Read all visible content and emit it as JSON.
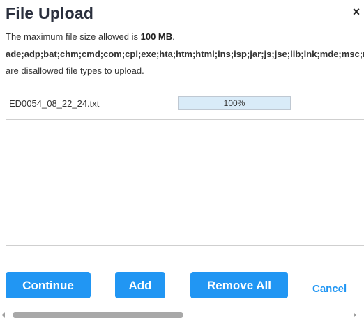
{
  "dialog": {
    "title": "File Upload",
    "close_label": "×"
  },
  "info": {
    "max_size_prefix": "The maximum file size allowed is ",
    "max_size_value": "100 MB",
    "max_size_suffix": ".",
    "disallowed_types": "ade;adp;bat;chm;cmd;com;cpl;exe;hta;htm;html;ins;isp;jar;js;jse;lib;lnk;mde;msc;msp;mst;pif;scr;sct;shb;sys;vb;vbe;vbs;vxd;wsc;wsf;wsh",
    "disallowed_note": "are disallowed file types to upload."
  },
  "files": [
    {
      "name": "ED0054_08_22_24.txt",
      "progress": 1.0,
      "progress_label": "100%"
    }
  ],
  "buttons": {
    "continue": "Continue",
    "add": "Add",
    "remove_all": "Remove All",
    "cancel": "Cancel"
  },
  "colors": {
    "primary": "#2196f3",
    "title": "#2a2f3d",
    "progress_fill": "#d9ebf8"
  }
}
